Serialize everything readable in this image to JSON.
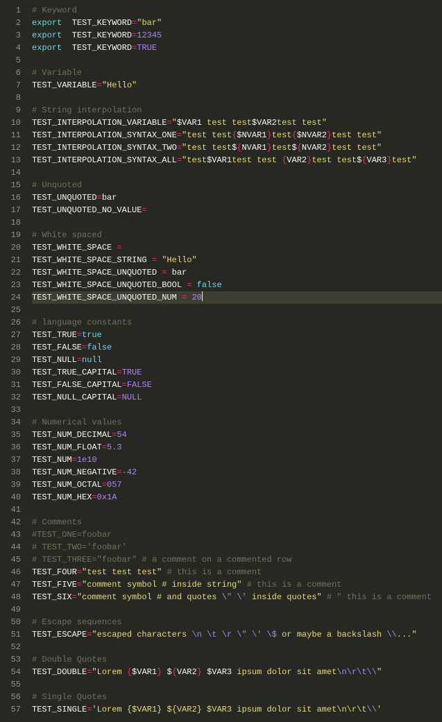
{
  "editor": {
    "highlighted_line": 24,
    "lines": [
      [
        {
          "c": "c-comment",
          "t": "# Keyword"
        }
      ],
      [
        {
          "c": "c-keyword",
          "t": "export"
        },
        {
          "c": "c-plain",
          "t": " "
        },
        {
          "c": "c-plain",
          "t": " TEST_KEYWORD"
        },
        {
          "c": "c-op",
          "t": "="
        },
        {
          "c": "c-string",
          "t": "\"bar\""
        }
      ],
      [
        {
          "c": "c-keyword",
          "t": "export"
        },
        {
          "c": "c-plain",
          "t": " "
        },
        {
          "c": "c-plain",
          "t": " TEST_KEYWORD"
        },
        {
          "c": "c-op",
          "t": "="
        },
        {
          "c": "c-num",
          "t": "12345"
        }
      ],
      [
        {
          "c": "c-keyword",
          "t": "export"
        },
        {
          "c": "c-plain",
          "t": " "
        },
        {
          "c": "c-plain",
          "t": " TEST_KEYWORD"
        },
        {
          "c": "c-op",
          "t": "="
        },
        {
          "c": "c-const",
          "t": "TRUE"
        }
      ],
      [],
      [
        {
          "c": "c-comment",
          "t": "# Variable"
        }
      ],
      [
        {
          "c": "c-plain",
          "t": "TEST_VARIABLE"
        },
        {
          "c": "c-op",
          "t": "="
        },
        {
          "c": "c-string",
          "t": "\"Hello\""
        }
      ],
      [],
      [
        {
          "c": "c-comment",
          "t": "# String interpolation"
        }
      ],
      [
        {
          "c": "c-plain",
          "t": "TEST_INTERPOLATION_VARIABLE"
        },
        {
          "c": "c-op",
          "t": "="
        },
        {
          "c": "c-string",
          "t": "\""
        },
        {
          "c": "c-interp",
          "t": "$VAR1"
        },
        {
          "c": "c-string",
          "t": " test test"
        },
        {
          "c": "c-interp",
          "t": "$VAR2"
        },
        {
          "c": "c-string",
          "t": "test test\""
        }
      ],
      [
        {
          "c": "c-plain",
          "t": "TEST_INTERPOLATION_SYNTAX_ONE"
        },
        {
          "c": "c-op",
          "t": "="
        },
        {
          "c": "c-string",
          "t": "\"test test"
        },
        {
          "c": "c-brace",
          "t": "{"
        },
        {
          "c": "c-interp",
          "t": "$NVAR1"
        },
        {
          "c": "c-brace",
          "t": "}"
        },
        {
          "c": "c-string",
          "t": "test"
        },
        {
          "c": "c-brace",
          "t": "{"
        },
        {
          "c": "c-interp",
          "t": "$NVAR2"
        },
        {
          "c": "c-brace",
          "t": "}"
        },
        {
          "c": "c-string",
          "t": "test test\""
        }
      ],
      [
        {
          "c": "c-plain",
          "t": "TEST_INTERPOLATION_SYNTAX_TWO"
        },
        {
          "c": "c-op",
          "t": "="
        },
        {
          "c": "c-string",
          "t": "\"test test"
        },
        {
          "c": "c-interp",
          "t": "$"
        },
        {
          "c": "c-brace",
          "t": "{"
        },
        {
          "c": "c-interp",
          "t": "NVAR1"
        },
        {
          "c": "c-brace",
          "t": "}"
        },
        {
          "c": "c-string",
          "t": "test"
        },
        {
          "c": "c-interp",
          "t": "$"
        },
        {
          "c": "c-brace",
          "t": "{"
        },
        {
          "c": "c-interp",
          "t": "NVAR2"
        },
        {
          "c": "c-brace",
          "t": "}"
        },
        {
          "c": "c-string",
          "t": "test test\""
        }
      ],
      [
        {
          "c": "c-plain",
          "t": "TEST_INTERPOLATION_SYNTAX_ALL"
        },
        {
          "c": "c-op",
          "t": "="
        },
        {
          "c": "c-string",
          "t": "\"test"
        },
        {
          "c": "c-interp",
          "t": "$VAR1"
        },
        {
          "c": "c-string",
          "t": "test test "
        },
        {
          "c": "c-brace",
          "t": "{"
        },
        {
          "c": "c-interp",
          "t": "VAR2"
        },
        {
          "c": "c-brace",
          "t": "}"
        },
        {
          "c": "c-string",
          "t": "test test"
        },
        {
          "c": "c-interp",
          "t": "$"
        },
        {
          "c": "c-brace",
          "t": "{"
        },
        {
          "c": "c-interp",
          "t": "VAR3"
        },
        {
          "c": "c-brace",
          "t": "}"
        },
        {
          "c": "c-string",
          "t": "test\""
        }
      ],
      [],
      [
        {
          "c": "c-comment",
          "t": "# Unquoted"
        }
      ],
      [
        {
          "c": "c-plain",
          "t": "TEST_UNQUOTED"
        },
        {
          "c": "c-op",
          "t": "="
        },
        {
          "c": "c-plain",
          "t": "bar"
        }
      ],
      [
        {
          "c": "c-plain",
          "t": "TEST_UNQUOTED_NO_VALUE"
        },
        {
          "c": "c-op",
          "t": "="
        }
      ],
      [],
      [
        {
          "c": "c-comment",
          "t": "# White spaced"
        }
      ],
      [
        {
          "c": "c-plain",
          "t": "TEST_WHITE_SPACE "
        },
        {
          "c": "c-op",
          "t": "="
        }
      ],
      [
        {
          "c": "c-plain",
          "t": "TEST_WHITE_SPACE_STRING "
        },
        {
          "c": "c-op",
          "t": "="
        },
        {
          "c": "c-plain",
          "t": " "
        },
        {
          "c": "c-string",
          "t": "\"Hello\""
        }
      ],
      [
        {
          "c": "c-plain",
          "t": "TEST_WHITE_SPACE_UNQUOTED "
        },
        {
          "c": "c-op",
          "t": "="
        },
        {
          "c": "c-plain",
          "t": " bar"
        }
      ],
      [
        {
          "c": "c-plain",
          "t": "TEST_WHITE_SPACE_UNQUOTED_BOOL "
        },
        {
          "c": "c-op",
          "t": "="
        },
        {
          "c": "c-plain",
          "t": " "
        },
        {
          "c": "c-bool",
          "t": "false"
        }
      ],
      [
        {
          "c": "c-plain",
          "t": "TEST_WHITE_SPACE_UNQUOTED_NUM "
        },
        {
          "c": "c-op",
          "t": "="
        },
        {
          "c": "c-plain",
          "t": " "
        },
        {
          "c": "c-num",
          "t": "20"
        },
        {
          "cursor": true
        }
      ],
      [],
      [
        {
          "c": "c-comment",
          "t": "# language constants"
        }
      ],
      [
        {
          "c": "c-plain",
          "t": "TEST_TRUE"
        },
        {
          "c": "c-op",
          "t": "="
        },
        {
          "c": "c-bool",
          "t": "true"
        }
      ],
      [
        {
          "c": "c-plain",
          "t": "TEST_FALSE"
        },
        {
          "c": "c-op",
          "t": "="
        },
        {
          "c": "c-bool",
          "t": "false"
        }
      ],
      [
        {
          "c": "c-plain",
          "t": "TEST_NULL"
        },
        {
          "c": "c-op",
          "t": "="
        },
        {
          "c": "c-bool",
          "t": "null"
        }
      ],
      [
        {
          "c": "c-plain",
          "t": "TEST_TRUE_CAPITAL"
        },
        {
          "c": "c-op",
          "t": "="
        },
        {
          "c": "c-const",
          "t": "TRUE"
        }
      ],
      [
        {
          "c": "c-plain",
          "t": "TEST_FALSE_CAPITAL"
        },
        {
          "c": "c-op",
          "t": "="
        },
        {
          "c": "c-const",
          "t": "FALSE"
        }
      ],
      [
        {
          "c": "c-plain",
          "t": "TEST_NULL_CAPITAL"
        },
        {
          "c": "c-op",
          "t": "="
        },
        {
          "c": "c-const",
          "t": "NULL"
        }
      ],
      [],
      [
        {
          "c": "c-comment",
          "t": "# Numerical values"
        }
      ],
      [
        {
          "c": "c-plain",
          "t": "TEST_NUM_DECIMAL"
        },
        {
          "c": "c-op",
          "t": "="
        },
        {
          "c": "c-num",
          "t": "54"
        }
      ],
      [
        {
          "c": "c-plain",
          "t": "TEST_NUM_FLOAT"
        },
        {
          "c": "c-op",
          "t": "="
        },
        {
          "c": "c-num",
          "t": "5.3"
        }
      ],
      [
        {
          "c": "c-plain",
          "t": "TEST_NUM"
        },
        {
          "c": "c-op",
          "t": "="
        },
        {
          "c": "c-num",
          "t": "1e10"
        }
      ],
      [
        {
          "c": "c-plain",
          "t": "TEST_NUM_NEGATIVE"
        },
        {
          "c": "c-op",
          "t": "="
        },
        {
          "c": "c-num",
          "t": "-42"
        }
      ],
      [
        {
          "c": "c-plain",
          "t": "TEST_NUM_OCTAL"
        },
        {
          "c": "c-op",
          "t": "="
        },
        {
          "c": "c-num",
          "t": "057"
        }
      ],
      [
        {
          "c": "c-plain",
          "t": "TEST_NUM_HEX"
        },
        {
          "c": "c-op",
          "t": "="
        },
        {
          "c": "c-num",
          "t": "0x1A"
        }
      ],
      [],
      [
        {
          "c": "c-comment",
          "t": "# Comments"
        }
      ],
      [
        {
          "c": "c-comment",
          "t": "#TEST_ONE=foobar"
        }
      ],
      [
        {
          "c": "c-comment",
          "t": "# TEST_TWO='foobar'"
        }
      ],
      [
        {
          "c": "c-comment",
          "t": "# TEST_THREE=\"foobar\" # a comment on a commented row"
        }
      ],
      [
        {
          "c": "c-plain",
          "t": "TEST_FOUR"
        },
        {
          "c": "c-op",
          "t": "="
        },
        {
          "c": "c-string",
          "t": "\"test test test\""
        },
        {
          "c": "c-plain",
          "t": " "
        },
        {
          "c": "c-comment",
          "t": "# this is a comment"
        }
      ],
      [
        {
          "c": "c-plain",
          "t": "TEST_FIVE"
        },
        {
          "c": "c-op",
          "t": "="
        },
        {
          "c": "c-string",
          "t": "\"comment symbol # inside string\""
        },
        {
          "c": "c-plain",
          "t": " "
        },
        {
          "c": "c-comment",
          "t": "# this is a comment"
        }
      ],
      [
        {
          "c": "c-plain",
          "t": "TEST_SIX"
        },
        {
          "c": "c-op",
          "t": "="
        },
        {
          "c": "c-string",
          "t": "\"comment symbol # and quotes "
        },
        {
          "c": "c-esc",
          "t": "\\\""
        },
        {
          "c": "c-string",
          "t": " "
        },
        {
          "c": "c-esc",
          "t": "\\'"
        },
        {
          "c": "c-string",
          "t": " inside quotes\""
        },
        {
          "c": "c-plain",
          "t": " "
        },
        {
          "c": "c-comment",
          "t": "# \" this is a comment"
        }
      ],
      [],
      [
        {
          "c": "c-comment",
          "t": "# Escape sequences"
        }
      ],
      [
        {
          "c": "c-plain",
          "t": "TEST_ESCAPE"
        },
        {
          "c": "c-op",
          "t": "="
        },
        {
          "c": "c-string",
          "t": "\"escaped characters "
        },
        {
          "c": "c-esc",
          "t": "\\n"
        },
        {
          "c": "c-string",
          "t": " "
        },
        {
          "c": "c-esc",
          "t": "\\t"
        },
        {
          "c": "c-string",
          "t": " "
        },
        {
          "c": "c-esc",
          "t": "\\r"
        },
        {
          "c": "c-string",
          "t": " "
        },
        {
          "c": "c-esc",
          "t": "\\\""
        },
        {
          "c": "c-string",
          "t": " "
        },
        {
          "c": "c-esc",
          "t": "\\'"
        },
        {
          "c": "c-string",
          "t": " "
        },
        {
          "c": "c-esc",
          "t": "\\$"
        },
        {
          "c": "c-string",
          "t": " or maybe a backslash "
        },
        {
          "c": "c-esc",
          "t": "\\\\"
        },
        {
          "c": "c-string",
          "t": "...\""
        }
      ],
      [],
      [
        {
          "c": "c-comment",
          "t": "# Double Quotes"
        }
      ],
      [
        {
          "c": "c-plain",
          "t": "TEST_DOUBLE"
        },
        {
          "c": "c-op",
          "t": "="
        },
        {
          "c": "c-string",
          "t": "\"Lorem "
        },
        {
          "c": "c-brace",
          "t": "{"
        },
        {
          "c": "c-interp",
          "t": "$VAR1"
        },
        {
          "c": "c-brace",
          "t": "}"
        },
        {
          "c": "c-string",
          "t": " "
        },
        {
          "c": "c-interp",
          "t": "$"
        },
        {
          "c": "c-brace",
          "t": "{"
        },
        {
          "c": "c-interp",
          "t": "VAR2"
        },
        {
          "c": "c-brace",
          "t": "}"
        },
        {
          "c": "c-string",
          "t": " "
        },
        {
          "c": "c-interp",
          "t": "$VAR3"
        },
        {
          "c": "c-string",
          "t": " ipsum dolor sit amet"
        },
        {
          "c": "c-esc",
          "t": "\\n\\r\\t\\\\"
        },
        {
          "c": "c-string",
          "t": "\""
        }
      ],
      [],
      [
        {
          "c": "c-comment",
          "t": "# Single Quotes"
        }
      ],
      [
        {
          "c": "c-plain",
          "t": "TEST_SINGLE"
        },
        {
          "c": "c-op",
          "t": "="
        },
        {
          "c": "c-string",
          "t": "'Lorem {$VAR1} ${VAR2} $VAR3 ipsum dolor sit amet\\n\\r\\t"
        },
        {
          "c": "c-esc",
          "t": "\\\\"
        },
        {
          "c": "c-string",
          "t": "'"
        }
      ]
    ]
  }
}
